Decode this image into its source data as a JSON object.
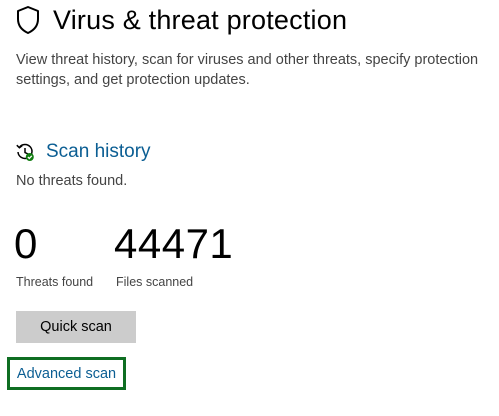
{
  "header": {
    "title": "Virus & threat protection",
    "icon": "shield-icon",
    "description_line1": "View threat history, scan for viruses and other threats, specify protection",
    "description_line2": "settings, and get protection updates."
  },
  "scan_history": {
    "title": "Scan history",
    "icon": "history-icon",
    "status": "No threats found."
  },
  "stats": {
    "threats_found_value": "0",
    "threats_found_label": "Threats found",
    "files_scanned_value": "44471",
    "files_scanned_label": "Files scanned"
  },
  "actions": {
    "quick_scan_label": "Quick scan",
    "advanced_scan_label": "Advanced scan"
  },
  "colors": {
    "link": "#0b5e93",
    "focus_ring": "#0f6e22",
    "button_bg": "#cccccc",
    "status_ok": "#107c10"
  }
}
